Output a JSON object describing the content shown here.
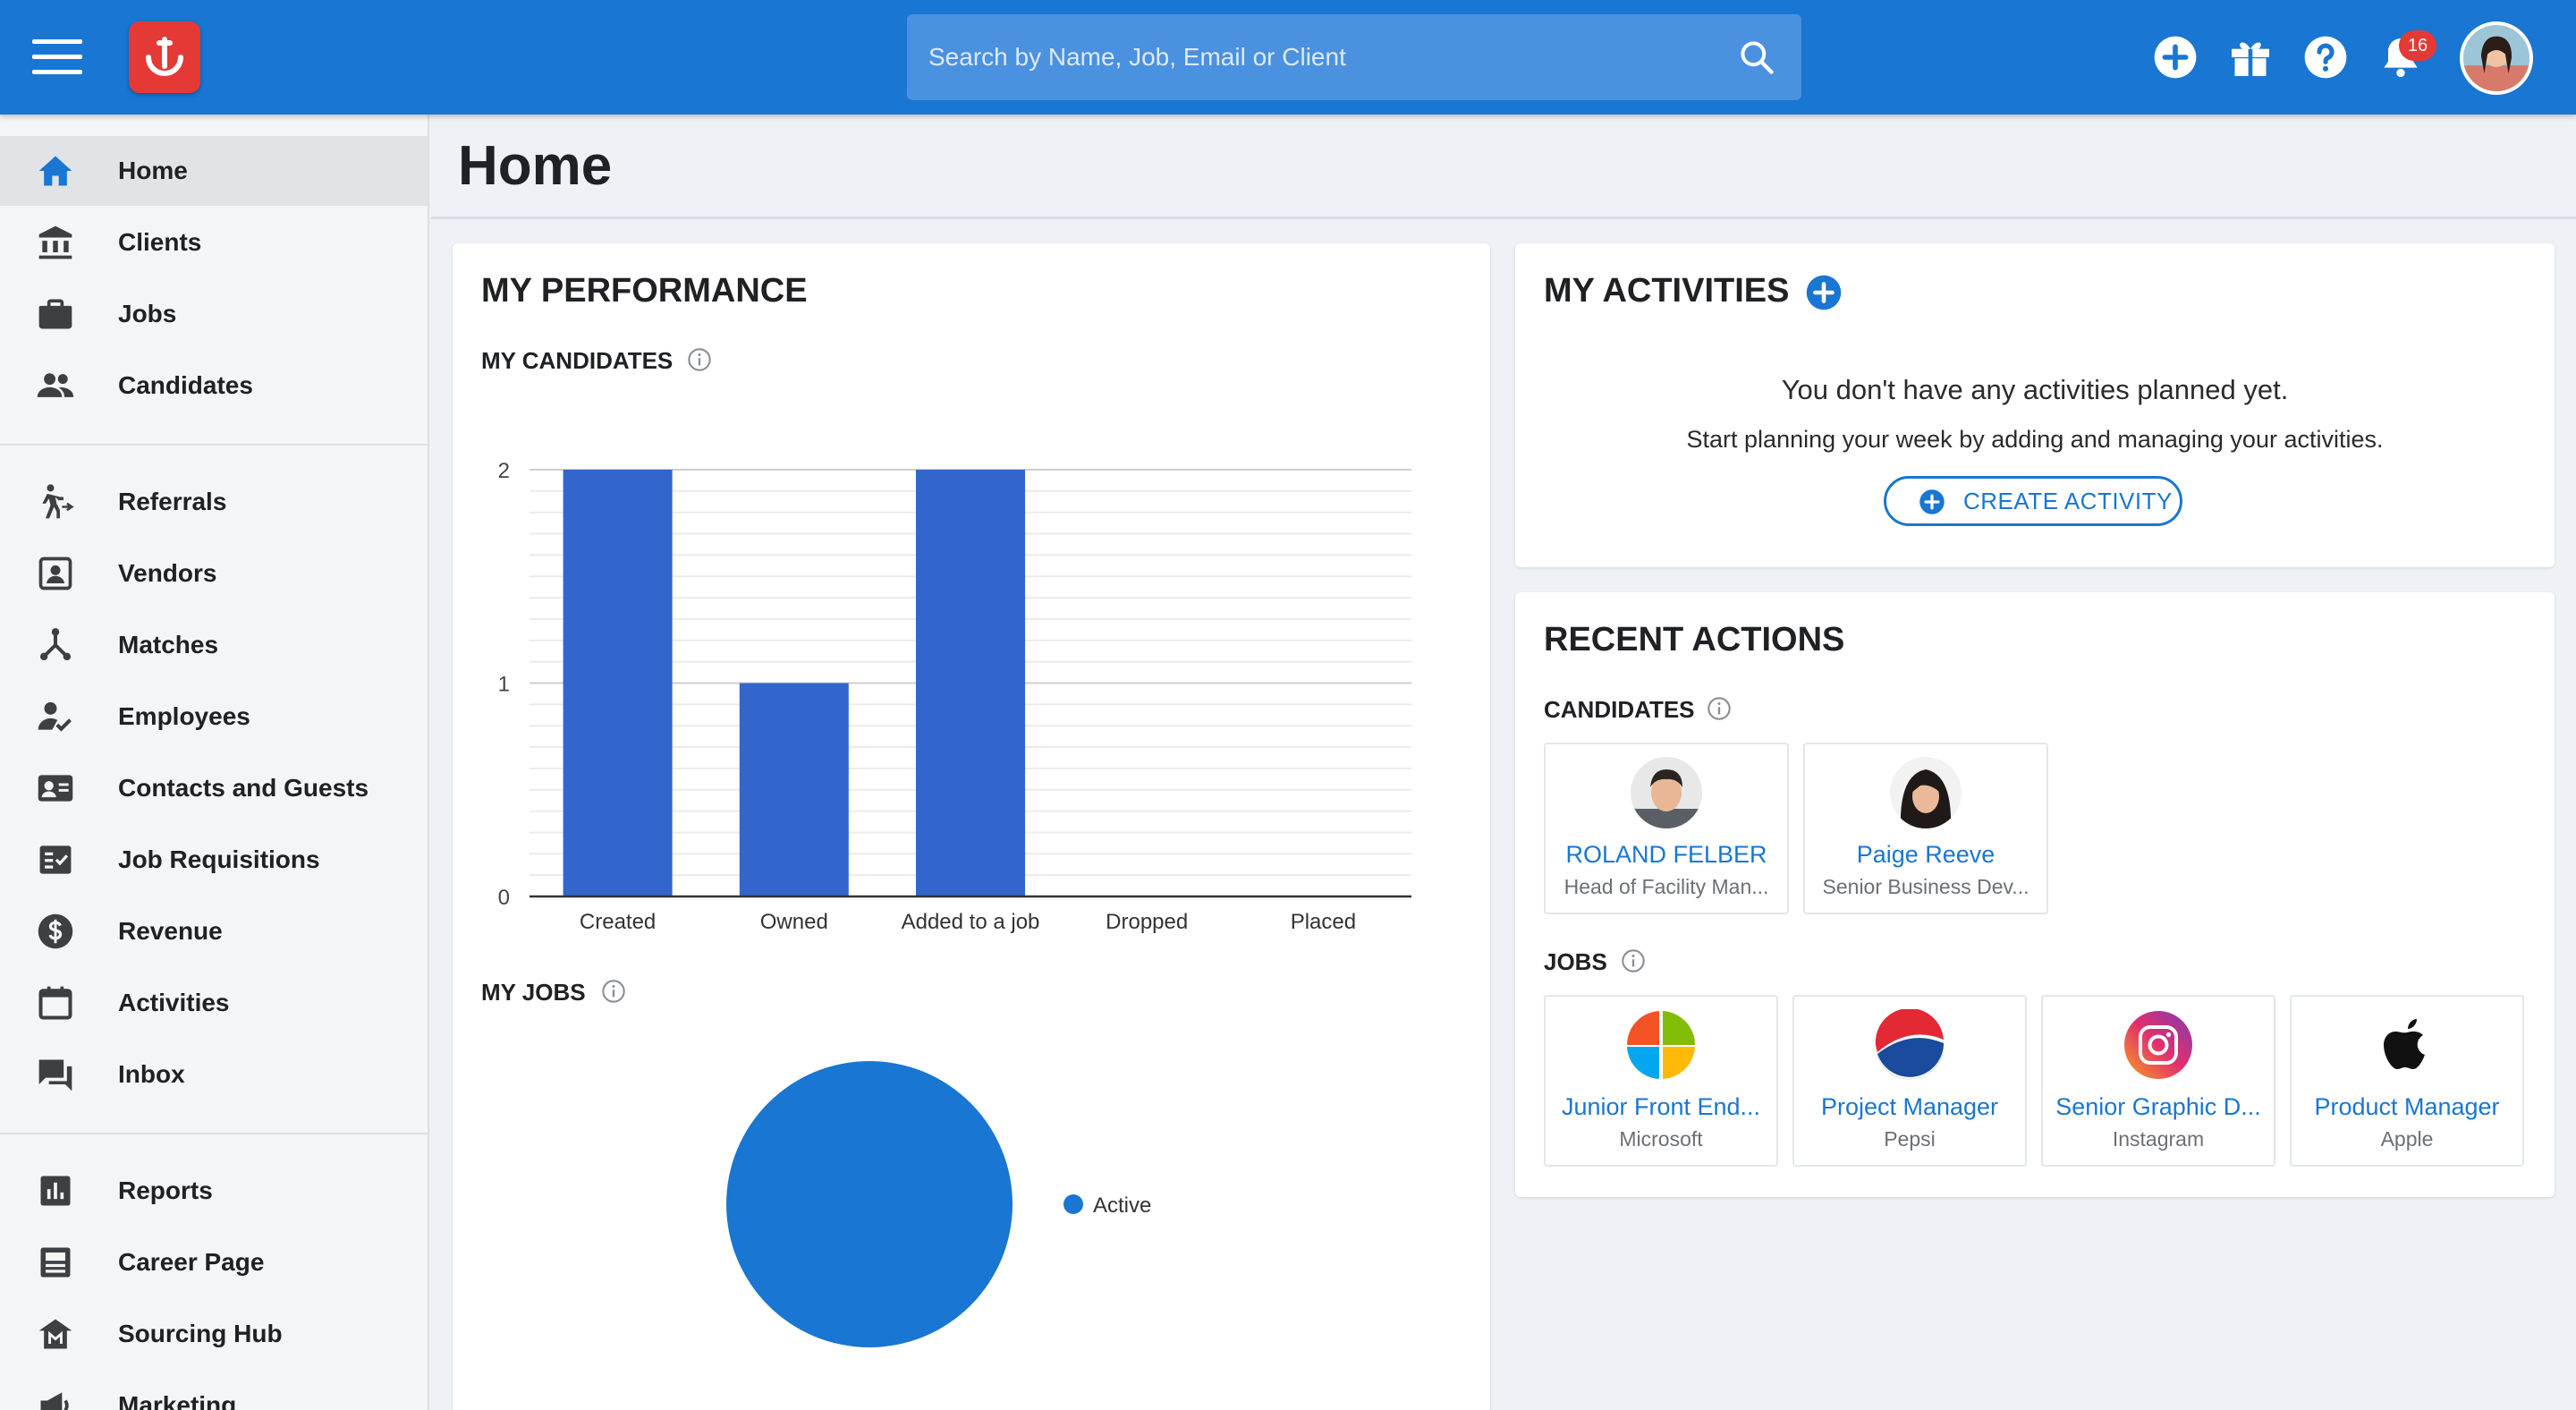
{
  "topbar": {
    "search_placeholder": "Search by Name, Job, Email or Client",
    "notification_count": "16"
  },
  "sidebar": {
    "items": [
      {
        "label": "Home",
        "icon": "home-icon"
      },
      {
        "label": "Clients",
        "icon": "bank-icon"
      },
      {
        "label": "Jobs",
        "icon": "briefcase-icon"
      },
      {
        "label": "Candidates",
        "icon": "people-icon"
      },
      {
        "label": "Referrals",
        "icon": "referral-icon"
      },
      {
        "label": "Vendors",
        "icon": "vendor-icon"
      },
      {
        "label": "Matches",
        "icon": "matches-icon"
      },
      {
        "label": "Employees",
        "icon": "employee-check-icon"
      },
      {
        "label": "Contacts and Guests",
        "icon": "contacts-icon"
      },
      {
        "label": "Job Requisitions",
        "icon": "requisition-icon"
      },
      {
        "label": "Revenue",
        "icon": "dollar-icon"
      },
      {
        "label": "Activities",
        "icon": "calendar-icon"
      },
      {
        "label": "Inbox",
        "icon": "inbox-icon"
      },
      {
        "label": "Reports",
        "icon": "bar-chart-icon"
      },
      {
        "label": "Career Page",
        "icon": "career-page-icon"
      },
      {
        "label": "Sourcing Hub",
        "icon": "sourcing-hub-icon"
      },
      {
        "label": "Marketing",
        "icon": "megaphone-icon"
      }
    ],
    "active": "Home"
  },
  "page": {
    "title": "Home"
  },
  "performance": {
    "title": "MY PERFORMANCE",
    "candidates_label": "MY CANDIDATES",
    "jobs_label": "MY JOBS"
  },
  "chart_data": [
    {
      "type": "bar",
      "title": "MY CANDIDATES",
      "categories": [
        "Created",
        "Owned",
        "Added to a job",
        "Dropped",
        "Placed"
      ],
      "values": [
        2,
        1,
        2,
        0,
        0
      ],
      "ylim": [
        0,
        2
      ],
      "yticks": [
        0,
        1,
        2
      ],
      "grid": true,
      "colors": [
        "#3366cc"
      ]
    },
    {
      "type": "pie",
      "title": "MY JOBS",
      "categories": [
        "Active"
      ],
      "values": [
        1
      ],
      "legend": "right",
      "colors": [
        "#1976d2"
      ]
    }
  ],
  "activities": {
    "title": "MY ACTIVITIES",
    "empty_title": "You don't have any activities planned yet.",
    "empty_sub": "Start planning your week by adding and managing your activities.",
    "create_label": "CREATE ACTIVITY"
  },
  "recent": {
    "title": "RECENT ACTIONS",
    "candidates_label": "CANDIDATES",
    "jobs_label": "JOBS",
    "candidates": [
      {
        "name": "ROLAND FELBER",
        "subtitle": "Head of Facility Man..."
      },
      {
        "name": "Paige Reeve",
        "subtitle": "Senior Business Dev..."
      }
    ],
    "jobs": [
      {
        "title": "Junior Front End...",
        "company": "Microsoft"
      },
      {
        "title": "Project Manager",
        "company": "Pepsi"
      },
      {
        "title": "Senior Graphic D...",
        "company": "Instagram"
      },
      {
        "title": "Product Manager",
        "company": "Apple"
      }
    ]
  },
  "colors": {
    "brand": "#1976d2",
    "accent_red": "#e53935",
    "bar": "#3366cc"
  }
}
